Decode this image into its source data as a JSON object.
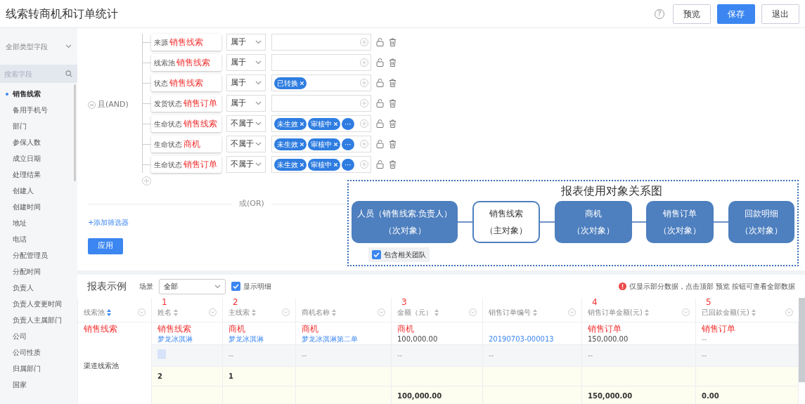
{
  "header": {
    "title": "线索转商机和订单统计",
    "help": "?",
    "buttons": [
      {
        "label": "预览",
        "kind": "default"
      },
      {
        "label": "保存",
        "kind": "primary"
      },
      {
        "label": "退出",
        "kind": "default"
      }
    ]
  },
  "sidebar": {
    "type_select": "全部类型字段",
    "search": {
      "placeholder": "搜索字段"
    },
    "items": [
      {
        "label": "销售线索",
        "selected": true
      },
      {
        "label": "备用手机号",
        "selected": false
      },
      {
        "label": "部门",
        "selected": false
      },
      {
        "label": "参保人数",
        "selected": false
      },
      {
        "label": "成立日期",
        "selected": false
      },
      {
        "label": "处理结果",
        "selected": false
      },
      {
        "label": "创建人",
        "selected": false
      },
      {
        "label": "创建时间",
        "selected": false
      },
      {
        "label": "地址",
        "selected": false
      },
      {
        "label": "电话",
        "selected": false
      },
      {
        "label": "分配管理员",
        "selected": false
      },
      {
        "label": "分配时间",
        "selected": false
      },
      {
        "label": "负责人",
        "selected": false
      },
      {
        "label": "负责人变更时间",
        "selected": false
      },
      {
        "label": "负责人主属部门",
        "selected": false
      },
      {
        "label": "公司",
        "selected": false
      },
      {
        "label": "公司性质",
        "selected": false
      },
      {
        "label": "归属部门",
        "selected": false
      },
      {
        "label": "国家",
        "selected": false
      }
    ]
  },
  "filter": {
    "group_label": "且(AND)",
    "conditions": [
      {
        "field": "来源",
        "annotation": "销售线索",
        "operator": "属于"
      },
      {
        "field": "线索池",
        "annotation": "销售线索",
        "operator": "属于"
      },
      {
        "field": "状态",
        "annotation": "销售线索",
        "operator": "属于",
        "tags": [
          {
            "label": "已转换",
            "removable": true
          }
        ]
      },
      {
        "field": "发货状态",
        "annotation": "销售订单",
        "operator": "属于"
      },
      {
        "field": "生命状态",
        "annotation": "销售线索",
        "operator": "不属于",
        "tags": [
          {
            "label": "未生效",
            "removable": true
          },
          {
            "label": "审核中",
            "removable": true
          },
          {
            "label": "···",
            "removable": false
          }
        ]
      },
      {
        "field": "生命状态",
        "annotation": "商机",
        "operator": "不属于",
        "tags": [
          {
            "label": "未生效",
            "removable": true
          },
          {
            "label": "审核中",
            "removable": true
          },
          {
            "label": "···",
            "removable": false
          }
        ]
      },
      {
        "field": "生命状态",
        "annotation": "销售订单",
        "operator": "不属于",
        "tags": [
          {
            "label": "未生效",
            "removable": true
          },
          {
            "label": "审核中",
            "removable": true
          },
          {
            "label": "···",
            "removable": false
          }
        ]
      }
    ],
    "or_label": "或(OR)",
    "add_filter": "+添加筛选器",
    "apply": "应用"
  },
  "diagram": {
    "title": "报表使用对象关系图",
    "nodes": [
      {
        "name": "人员（销售线索.负责人）",
        "role": "（次对象）",
        "main": false
      },
      {
        "name": "销售线索",
        "role": "（主对象）",
        "main": true
      },
      {
        "name": "商机",
        "role": "（次对象）",
        "main": false
      },
      {
        "name": "销售订单",
        "role": "（次对象）",
        "main": false
      },
      {
        "name": "回款明细",
        "role": "（次对象）",
        "main": false
      }
    ],
    "team_checkbox": {
      "label": "包含相关团队",
      "checked": true
    }
  },
  "report": {
    "title": "报表示例",
    "scene_label": "场景",
    "scene": "全部",
    "show_detail": {
      "label": "显示明细",
      "checked": true
    },
    "notice": {
      "before": "仅显示部分数据，点击顶部 ",
      "link": "预览",
      "after": " 按钮可查看全部数据"
    }
  },
  "table": {
    "columns": [
      {
        "label": "线索池",
        "sorted": true,
        "annotation": "销售线索"
      },
      {
        "label": "姓名",
        "sorted": false,
        "marker": "1",
        "annotation": "销售线索"
      },
      {
        "label": "主线索",
        "sorted": false,
        "marker": "2",
        "annotation": "商机"
      },
      {
        "label": "商机名称",
        "sorted": false,
        "annotation": "商机"
      },
      {
        "label": "金额（元）",
        "sorted": false,
        "marker": "3",
        "annotation": "商机"
      },
      {
        "label": "销售订单编号",
        "sorted": false
      },
      {
        "label": "销售订单金额(元)",
        "sorted": false,
        "marker": "4",
        "annotation": "销售订单"
      },
      {
        "label": "已回款金额(元)",
        "sorted": false,
        "marker": "5",
        "annotation": "销售订单"
      }
    ],
    "rows": [
      {
        "kind": "data",
        "cells": [
          {
            "text": "渠道线索池",
            "rowspan": 4
          },
          {
            "text": "梦龙冰淇淋",
            "link": true
          },
          {
            "text": "梦龙冰淇淋",
            "link": true
          },
          {
            "text": "梦龙冰淇淋第二单",
            "link": true
          },
          {
            "text": "100,000.00",
            "link": false
          },
          {
            "text": "20190703-000013",
            "link": true
          },
          {
            "text": "150,000.00",
            "link": false
          },
          {
            "text": "--",
            "link": false
          }
        ]
      },
      {
        "kind": "data",
        "shaded": true,
        "cells": [
          {
            "kind": "thumb"
          },
          {
            "text": "--",
            "link": false
          },
          {
            "text": "--",
            "link": false
          },
          {
            "text": "--",
            "link": false
          },
          {
            "text": "--",
            "link": false
          },
          {
            "text": "--",
            "link": false
          },
          {
            "text": "--",
            "link": false
          }
        ]
      },
      {
        "kind": "total",
        "cells": [
          {
            "text": "2"
          },
          {
            "text": "1"
          },
          null,
          null,
          null,
          null,
          null
        ]
      },
      {
        "kind": "total",
        "cells": [
          null,
          null,
          null,
          {
            "text": "100,000.00"
          },
          null,
          {
            "text": "150,000.00"
          },
          {
            "text": "0.00"
          }
        ]
      }
    ]
  }
}
